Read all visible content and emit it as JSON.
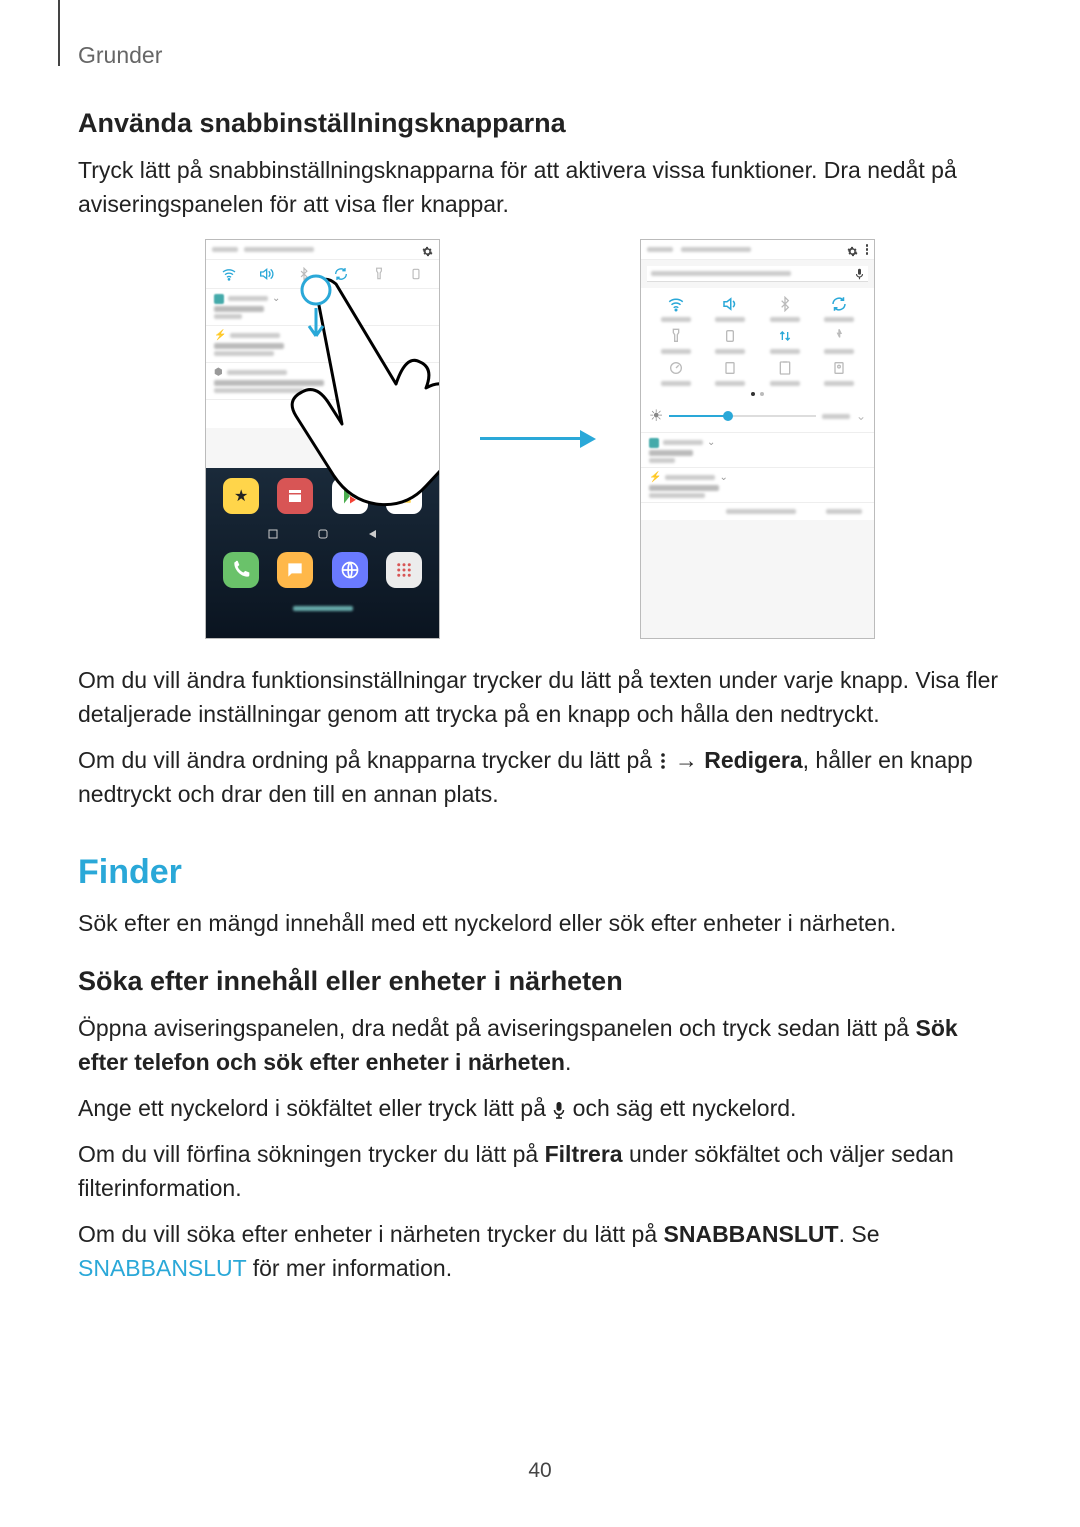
{
  "header": {
    "breadcrumb": "Grunder"
  },
  "section1": {
    "heading": "Använda snabbinställningsknapparna",
    "para1": "Tryck lätt på snabbinställningsknapparna för att aktivera vissa funktioner. Dra nedåt på aviseringspanelen för att visa fler knappar.",
    "para2": "Om du vill ändra funktionsinställningar trycker du lätt på texten under varje knapp. Visa fler detaljerade inställningar genom att trycka på en knapp och hålla den nedtryckt.",
    "para3_a": "Om du vill ändra ordning på knapparna trycker du lätt på ",
    "para3_b": " → ",
    "para3_c": "Redigera",
    "para3_d": ", håller en knapp nedtryckt och drar den till en annan plats."
  },
  "section2": {
    "heading": "Finder",
    "para1": "Sök efter en mängd innehåll med ett nyckelord eller sök efter enheter i närheten.",
    "subhead": "Söka efter innehåll eller enheter i närheten",
    "para2_a": "Öppna aviseringspanelen, dra nedåt på aviseringspanelen och tryck sedan lätt på ",
    "para2_b": "Sök efter telefon och sök efter enheter i närheten",
    "para2_c": ".",
    "para3_a": "Ange ett nyckelord i sökfältet eller tryck lätt på ",
    "para3_b": " och säg ett nyckelord.",
    "para4_a": "Om du vill förfina sökningen trycker du lätt på ",
    "para4_b": "Filtrera",
    "para4_c": " under sökfältet och väljer sedan filterinformation.",
    "para5_a": "Om du vill söka efter enheter i närheten trycker du lätt på ",
    "para5_b": "SNABBANSLUT",
    "para5_c": ". Se ",
    "para5_link": "SNABBANSLUT",
    "para5_d": " för mer information."
  },
  "page_number": "40"
}
